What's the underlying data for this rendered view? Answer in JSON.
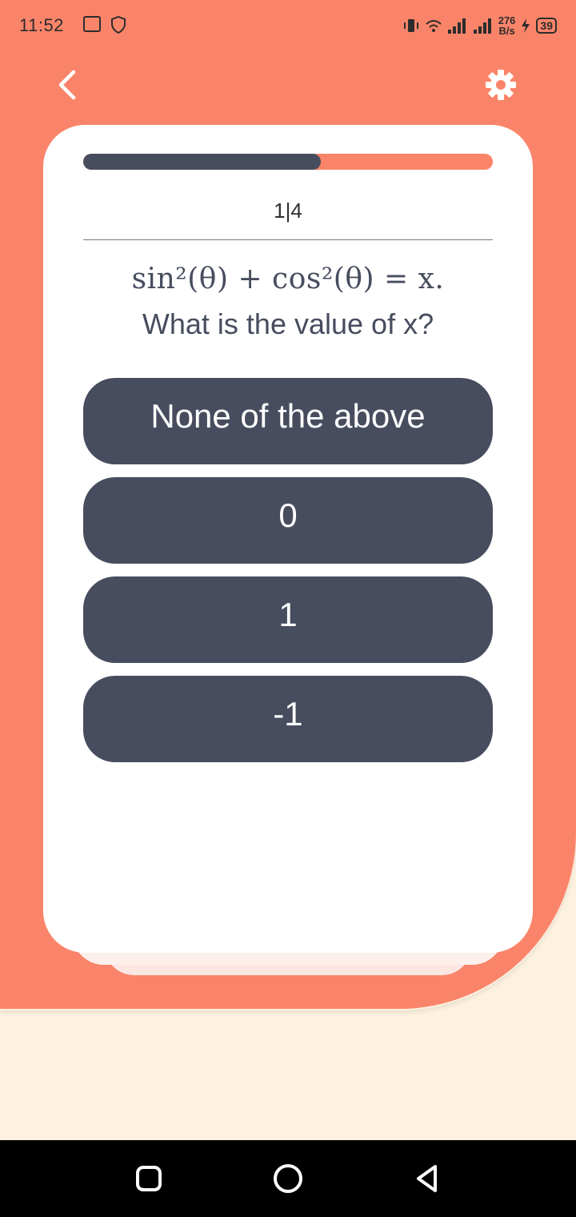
{
  "status_bar": {
    "time": "11:52",
    "speed_value": "276",
    "speed_unit": "B/s",
    "battery": "39"
  },
  "quiz": {
    "progress": 0.58,
    "counter": "1|4",
    "equation": "sin²(θ) + cos²(θ) = x.",
    "question": "What is the value of x?",
    "options": [
      {
        "label": "None of the above"
      },
      {
        "label": "0"
      },
      {
        "label": "1"
      },
      {
        "label": "-1"
      }
    ]
  },
  "icons": {
    "back": "chevron-left-icon",
    "settings": "gear-icon",
    "nav_recents": "square-icon",
    "nav_home": "circle-icon",
    "nav_back": "triangle-back-icon"
  },
  "colors": {
    "accent": "#FA8469",
    "button": "#474D5E",
    "page_bg": "#FDF1DF",
    "card": "#FFFFFF"
  }
}
